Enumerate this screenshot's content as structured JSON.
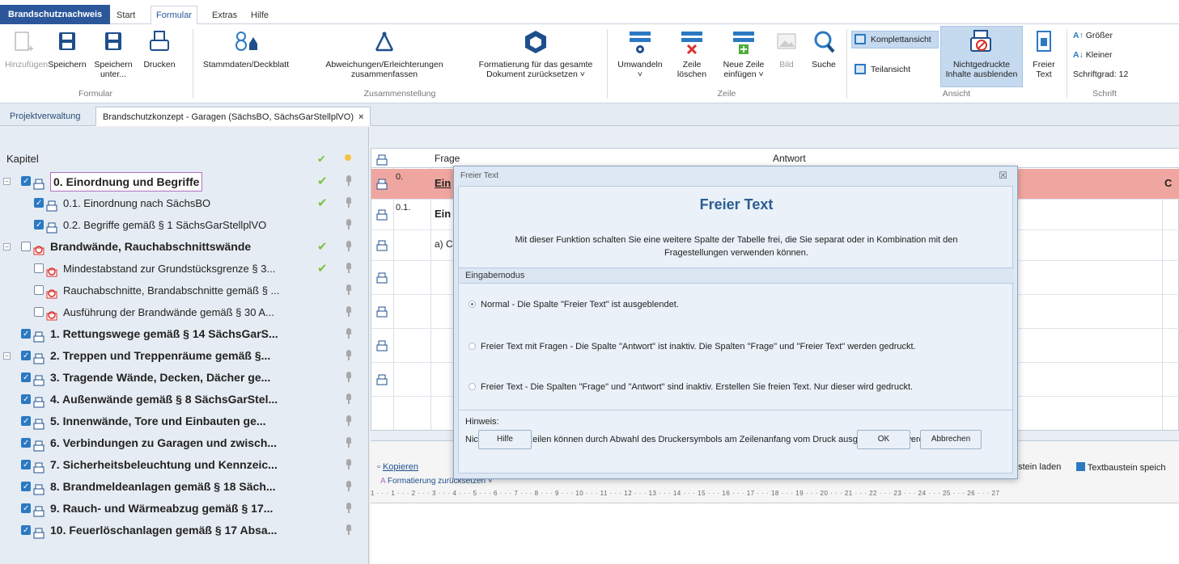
{
  "app_tab": "Brandschutznachweis",
  "ribbon_tabs": [
    "Start",
    "Formular",
    "Extras",
    "Hilfe"
  ],
  "ribbon": {
    "formular": {
      "label": "Formular",
      "buttons": [
        "Hinzufügen",
        "Speichern",
        "Speichern",
        "unter...",
        "Drucken"
      ]
    },
    "zusammenstellung": {
      "label": "Zusammenstellung",
      "stammdaten": "Stammdaten/Deckblatt",
      "abweichungen_1": "Abweichungen/Erleichterungen",
      "abweichungen_2": "zusammenfassen",
      "formatierung_1": "Formatierung für das gesamte",
      "formatierung_2": "Dokument zurücksetzen ˅"
    },
    "zeile": {
      "label": "Zeile",
      "umwandeln": "Umwandeln",
      "umwandeln_arrow": "˅",
      "zeile_loeschen_1": "Zeile",
      "zeile_loeschen_2": "löschen",
      "neue_zeile_1": "Neue Zeile",
      "neue_zeile_2": "einfügen ˅",
      "bild": "Bild",
      "suche": "Suche"
    },
    "ansicht": {
      "label": "Ansicht",
      "komplettansicht": "Komplettansicht",
      "teilansicht": "Teilansicht",
      "nichtgedruckte_1": "Nichtgedruckte",
      "nichtgedruckte_2": "Inhalte ausblenden",
      "freier_1": "Freier",
      "freier_2": "Text"
    },
    "schrift": {
      "label": "Schrift",
      "groesser": "Größer",
      "kleiner": "Kleiner",
      "schriftgrad": "Schriftgrad: 12"
    }
  },
  "doc_tabs": {
    "projekt": "Projektverwaltung",
    "active": "Brandschutzkonzept - Garagen (SächsBO, SächsGarStellplVO)",
    "close": "×"
  },
  "tree": {
    "header": "Kapitel",
    "rows": [
      {
        "label": "0. Einordnung und Begriffe",
        "check": "✔"
      },
      {
        "label": "0.1. Einordnung nach SächsBO",
        "check": "✔"
      },
      {
        "label": "0.2. Begriffe gemäß § 1 SächsGarStellplVO",
        "check": ""
      },
      {
        "label": "Brandwände, Rauchabschnittswände",
        "check": "✔"
      },
      {
        "label": "Mindestabstand zur Grundstücksgrenze § 3...",
        "check": "✔"
      },
      {
        "label": "Rauchabschnitte, Brandabschnitte gemäß § ...",
        "check": ""
      },
      {
        "label": "Ausführung der Brandwände gemäß § 30 A...",
        "check": ""
      },
      {
        "label": "1. Rettungswege gemäß § 14 SächsGarS...",
        "check": ""
      },
      {
        "label": "2. Treppen und Treppenräume gemäß §...",
        "check": ""
      },
      {
        "label": "3. Tragende Wände, Decken, Dächer ge...",
        "check": ""
      },
      {
        "label": "4. Außenwände gemäß § 8 SächsGarStel...",
        "check": ""
      },
      {
        "label": "5. Innenwände, Tore und Einbauten ge...",
        "check": ""
      },
      {
        "label": "6. Verbindungen zu Garagen und zwisch...",
        "check": ""
      },
      {
        "label": "7. Sicherheitsbeleuchtung und Kennzeic...",
        "check": ""
      },
      {
        "label": "8. Brandmeldeanlagen gemäß § 18 Säch...",
        "check": ""
      },
      {
        "label": "9. Rauch- und Wärmeabzug gemäß § 17...",
        "check": ""
      },
      {
        "label": "10. Feuerlöschanlagen gemäß § 17 Absa...",
        "check": ""
      }
    ],
    "head_check": "✔"
  },
  "grid": {
    "col_frage": "Frage",
    "col_antwort": "Antwort",
    "rows": [
      {
        "nr": "0.",
        "frage": "Ein",
        "right": "C"
      },
      {
        "nr": "0.1.",
        "frage": "Ein",
        "right": ""
      },
      {
        "nr": "",
        "frage": "a) C",
        "right": ""
      }
    ]
  },
  "editor": {
    "kopieren": "Kopieren",
    "textbaustein_laden": "ustein laden",
    "textbaustein_speichern": "Textbaustein speich",
    "formatierung": "Formatierung zurücksetzen ˅",
    "ruler": "1 · · · 1 · · · 2 · · · 3 · · · 4 · · · 5 · · · 6 · · · 7 · · · 8 · · · 9 · · · 10 · · · 11 · · · 12 · · · 13 · · · 14 · · · 15 · · · 16 · · · 17 · · · 18 · · · 19 · · · 20 · · · 21 · · · 22 · · · 23 · · · 24 · · · 25 · · · 26 · · · 27"
  },
  "dialog": {
    "window_title": "Freier Text",
    "close": "☒",
    "heading": "Freier Text",
    "description": "Mit dieser Funktion schalten Sie eine weitere Spalte der Tabelle frei, die Sie separat oder in Kombination mit den Fragestellungen verwenden können.",
    "section": "Eingabemodus",
    "options": [
      "Normal - Die Spalte \"Freier Text\" ist ausgeblendet.",
      "Freier Text mit Fragen - Die Spalte \"Antwort\" ist inaktiv. Die Spalten \"Frage\" und \"Freier Text\"  werden gedruckt.",
      "Freier Text - Die Spalten \"Frage\" und \"Antwort\" sind inaktiv. Erstellen Sie freien Text. Nur dieser wird gedruckt."
    ],
    "selected_option": 0,
    "hint_label": "Hinweis:",
    "hint_text": "Nicht benötigte Zeilen können durch Abwahl des Druckersymbols am Zeilenanfang vom Druck ausgeschlossen werden.",
    "btn_hilfe": "Hilfe",
    "btn_ok": "OK",
    "btn_abbrechen": "Abbrechen"
  },
  "colors": {
    "accent": "#2b579a",
    "check_green": "#7cc242",
    "row_red": "#f0a6a0",
    "dialog_heading": "#2b5d92"
  }
}
